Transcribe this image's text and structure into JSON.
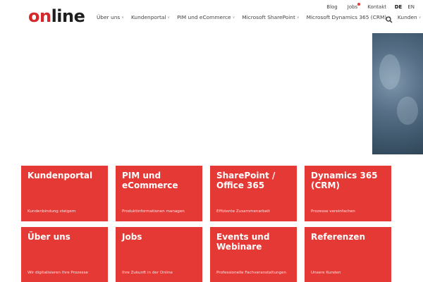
{
  "logo": {
    "part1": "on",
    "part2": "line"
  },
  "topbar": {
    "links": [
      "Blog",
      "Jobs",
      "Kontakt"
    ],
    "langs": [
      "DE",
      "EN"
    ],
    "active_lang": "DE"
  },
  "nav": {
    "items": [
      "Über uns",
      "Kundenportal",
      "PIM und eCommerce",
      "Microsoft SharePoint",
      "Microsoft Dynamics 365 (CRM)",
      "Kunden"
    ]
  },
  "tiles": [
    {
      "title": "Kundenportal",
      "subtitle": "Kundenbindung steigern"
    },
    {
      "title": "PIM und eCommerce",
      "subtitle": "Produktinformationen managen"
    },
    {
      "title": "SharePoint / Office 365",
      "subtitle": "Effiziente Zusammenarbeit"
    },
    {
      "title": "Dynamics 365 (CRM)",
      "subtitle": "Prozesse vereinfachen"
    },
    {
      "title": "Über uns",
      "subtitle": "Wir digitalisieren Ihre Prozesse"
    },
    {
      "title": "Jobs",
      "subtitle": "Ihre Zukunft in der Online"
    },
    {
      "title": "Events und Webinare",
      "subtitle": "Professionelle Fachveranstaltungen"
    },
    {
      "title": "Referenzen",
      "subtitle": "Unsere Kunden"
    }
  ],
  "colors": {
    "brand_red": "#e53935",
    "logo_red": "#d6282b"
  },
  "icons": {
    "search": "search-icon",
    "chevron": "chevron-down-icon",
    "notification": "notification-dot"
  }
}
